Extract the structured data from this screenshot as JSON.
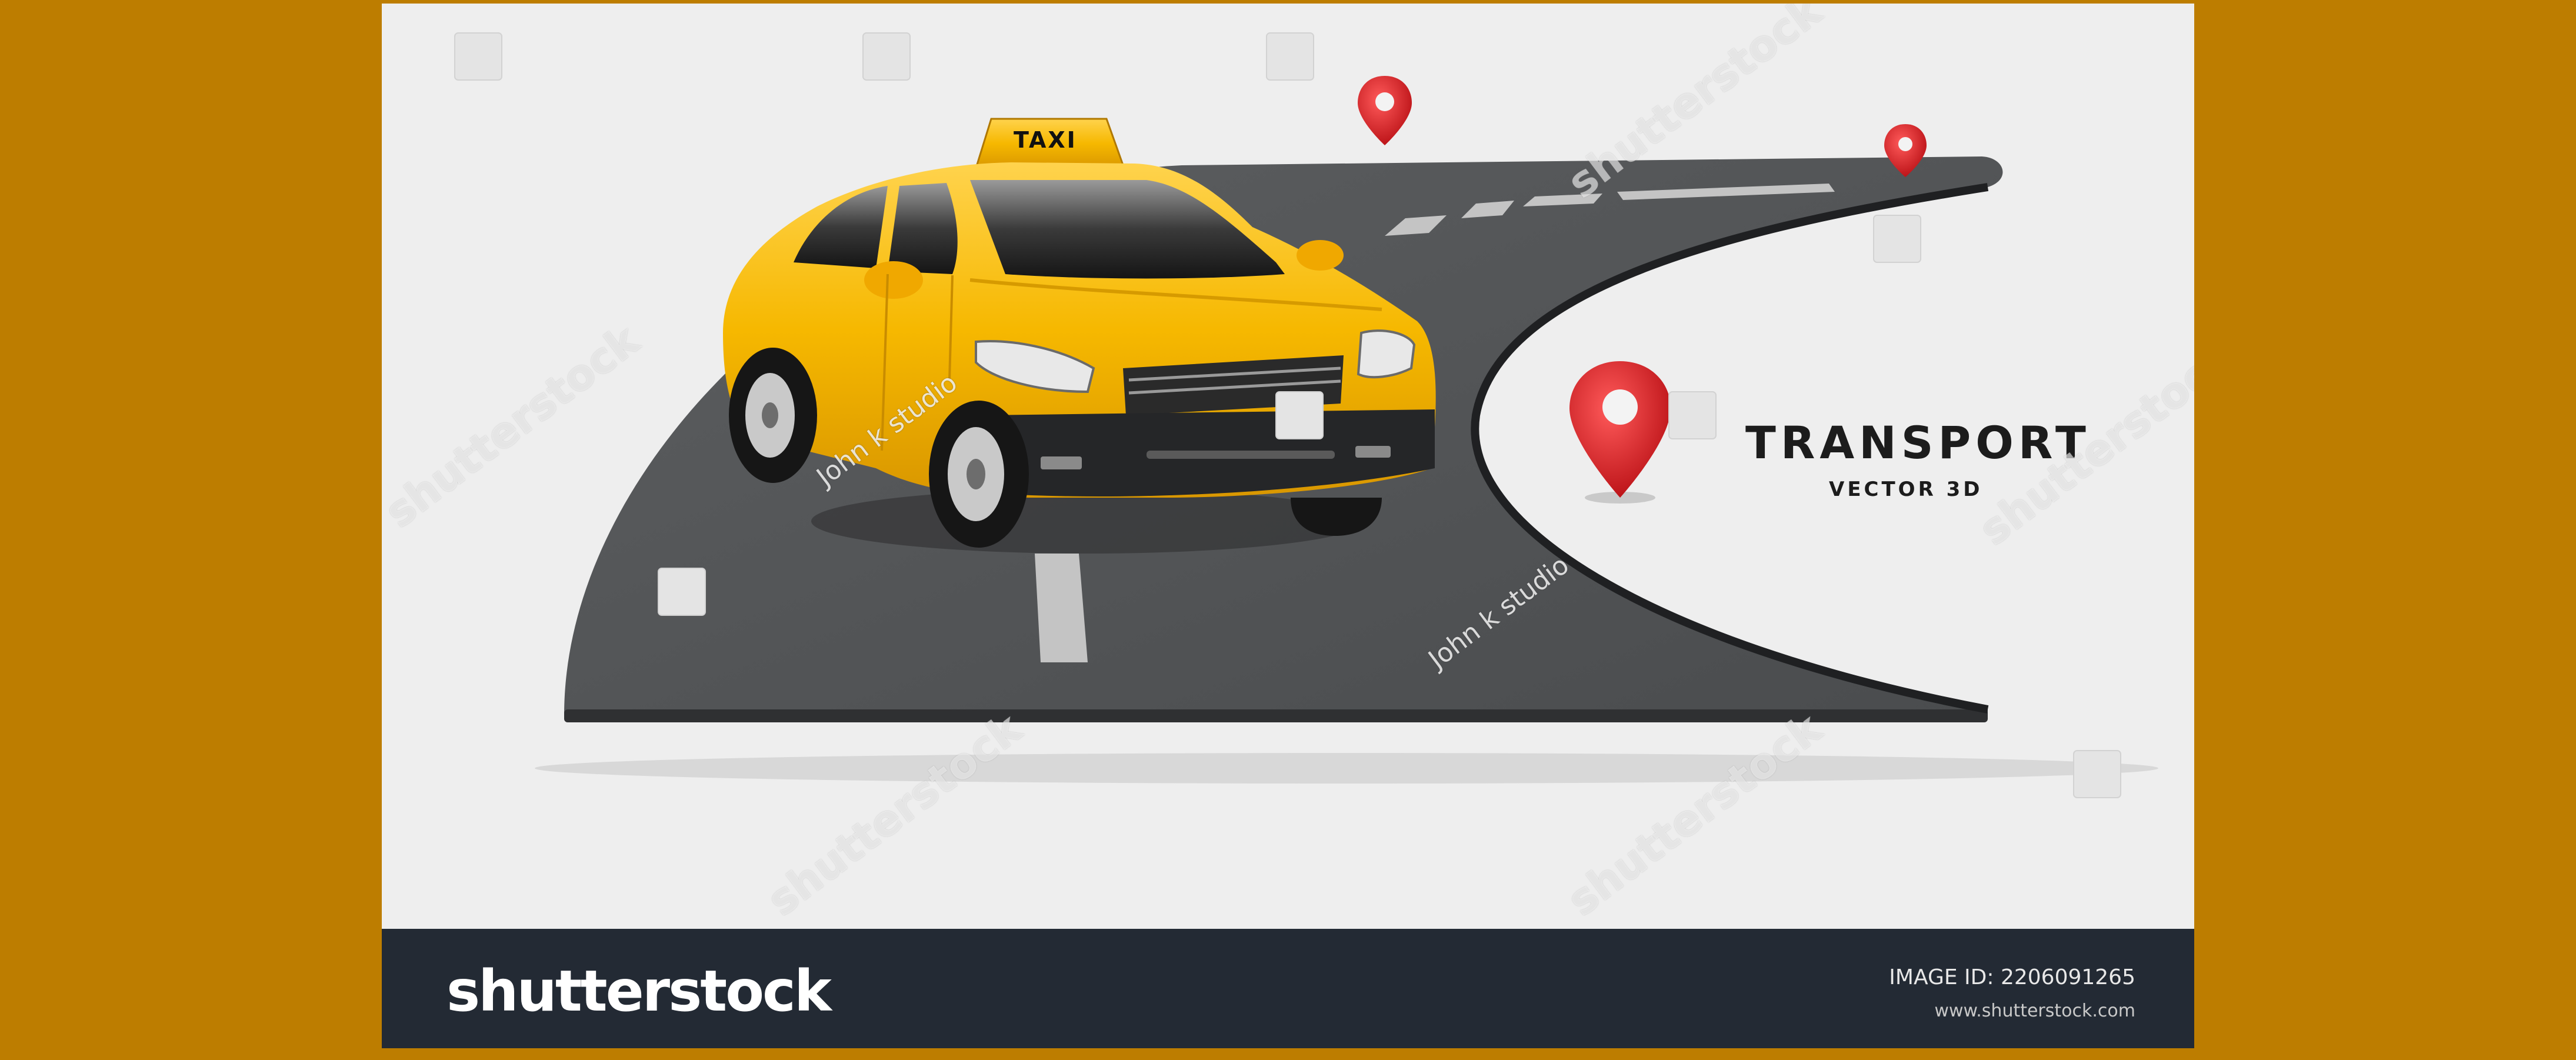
{
  "artwork": {
    "headline": "TRANSPORT",
    "subline": "VECTOR 3D",
    "taxi_sign": "TAXI",
    "pin_icon": "map-pin-icon",
    "colors": {
      "taxi_yellow": "#f6b800",
      "road": "#555759",
      "pin_red": "#e3262b",
      "background": "#eeeeee",
      "side_bars": "#bd7d00"
    }
  },
  "watermarks": {
    "brand": "shutterstock",
    "artist": "John k studio"
  },
  "footer": {
    "logo": "shutterstock",
    "image_id": "IMAGE ID: 2206091265",
    "url": "www.shutterstock.com",
    "background": "#232a34"
  }
}
